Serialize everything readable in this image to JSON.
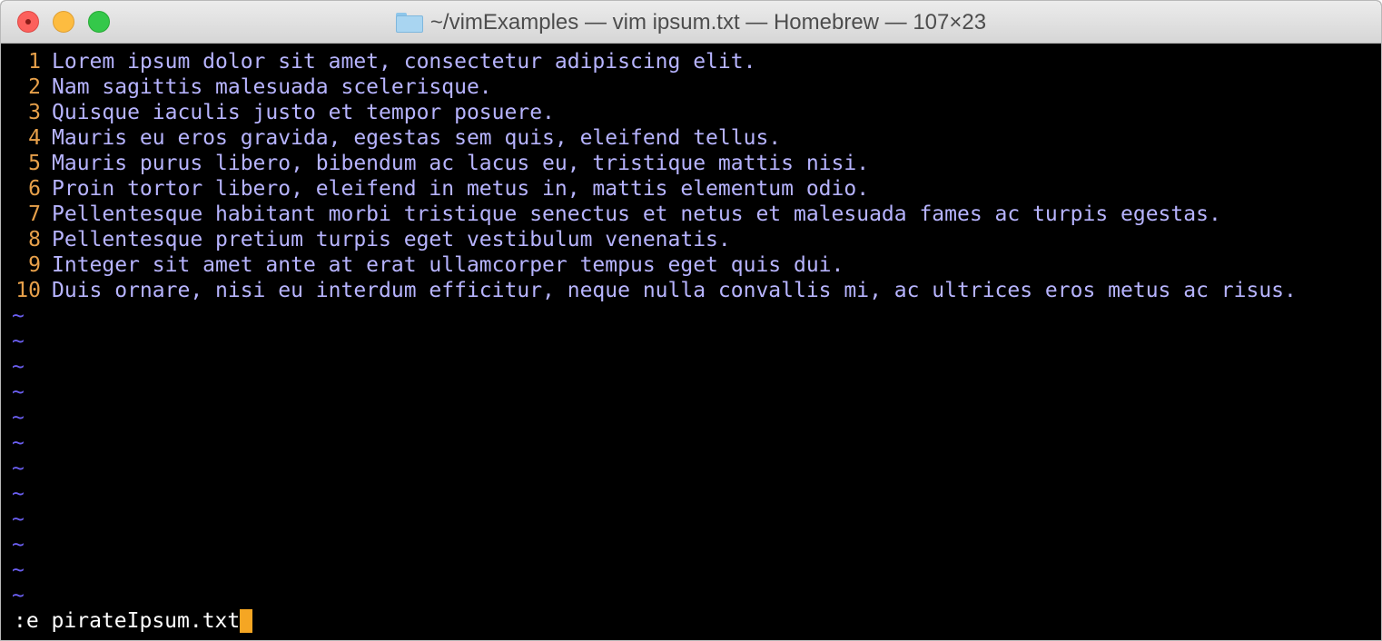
{
  "window": {
    "title": "~/vimExamples — vim ipsum.txt — Homebrew — 107×23",
    "folder_icon": "folder-icon"
  },
  "buffer": {
    "lines": [
      {
        "num": "1",
        "text": "Lorem ipsum dolor sit amet, consectetur adipiscing elit."
      },
      {
        "num": "2",
        "text": "Nam sagittis malesuada scelerisque."
      },
      {
        "num": "3",
        "text": "Quisque iaculis justo et tempor posuere."
      },
      {
        "num": "4",
        "text": "Mauris eu eros gravida, egestas sem quis, eleifend tellus."
      },
      {
        "num": "5",
        "text": "Mauris purus libero, bibendum ac lacus eu, tristique mattis nisi."
      },
      {
        "num": "6",
        "text": "Proin tortor libero, eleifend in metus in, mattis elementum odio."
      },
      {
        "num": "7",
        "text": "Pellentesque habitant morbi tristique senectus et netus et malesuada fames ac turpis egestas."
      },
      {
        "num": "8",
        "text": "Pellentesque pretium turpis eget vestibulum venenatis."
      },
      {
        "num": "9",
        "text": "Integer sit amet ante at erat ullamcorper tempus eget quis dui."
      },
      {
        "num": "10",
        "text": "Duis ornare, nisi eu interdum efficitur, neque nulla convallis mi, ac ultrices eros metus ac risus."
      }
    ],
    "empty_marker": "~",
    "empty_line_count": 12
  },
  "command_line": {
    "text": ":e pirateIpsum.txt"
  },
  "colors": {
    "background": "#000000",
    "text": "#b7b4ff",
    "line_number": "#e7a04a",
    "tilde": "#6b5ff2",
    "cursor": "#f5a623"
  }
}
